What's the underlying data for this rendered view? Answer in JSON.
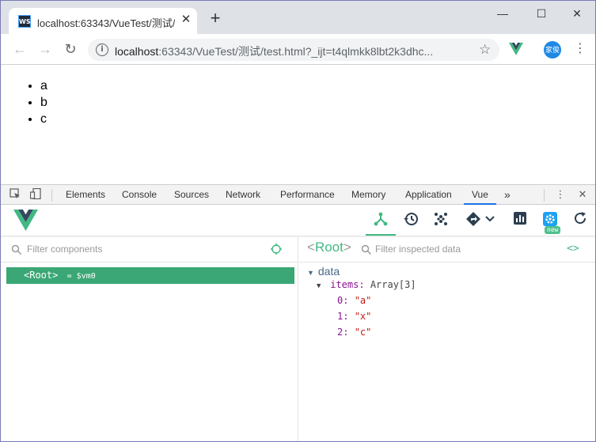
{
  "browser": {
    "tab_title": "localhost:63343/VueTest/测试/",
    "tab_favicon": "WS",
    "close_tab": "✕",
    "new_tab": "+",
    "window_controls": {
      "minimize": "—",
      "maximize": "☐",
      "close": "✕"
    },
    "url_host": "localhost",
    "url_rest": ":63343/VueTest/测试/test.html?_ijt=t4qlmkk8lbt2k3dhc...",
    "avatar_text": "家俊"
  },
  "page": {
    "list": [
      "a",
      "b",
      "c"
    ]
  },
  "devtools": {
    "tabs": [
      "Elements",
      "Console",
      "Sources",
      "Network",
      "Performance",
      "Memory",
      "Application",
      "Vue"
    ],
    "active_tab": "Vue",
    "more": "»"
  },
  "vue_devtools": {
    "new_badge": "new",
    "components": {
      "filter_placeholder": "Filter components",
      "root_label": "<Root>",
      "root_ref": "= $vm0"
    },
    "inspector": {
      "title_open": "<",
      "title_name": "Root",
      "title_close": ">",
      "filter_placeholder": "Filter inspected data",
      "code_icon": "<>",
      "section": "data",
      "items_key": "items",
      "items_type": "Array[3]",
      "entries": [
        {
          "index": "0",
          "value": "\"a\""
        },
        {
          "index": "1",
          "value": "\"x\""
        },
        {
          "index": "2",
          "value": "\"c\""
        }
      ]
    }
  },
  "colors": {
    "vue_green": "#42b983",
    "selection": "#3ba776",
    "accent_blue": "#1a73e8"
  },
  "icons": [
    "back-icon",
    "forward-icon",
    "reload-icon",
    "info-icon",
    "star-icon",
    "vue-extension-icon",
    "menu-icon",
    "inspect-icon",
    "device-toolbar-icon",
    "kebab-icon",
    "close-devtools-icon",
    "components-icon",
    "history-icon",
    "vuex-icon",
    "routing-icon",
    "performance-icon",
    "settings-icon",
    "refresh-icon",
    "search-icon",
    "target-icon",
    "code-icon"
  ]
}
